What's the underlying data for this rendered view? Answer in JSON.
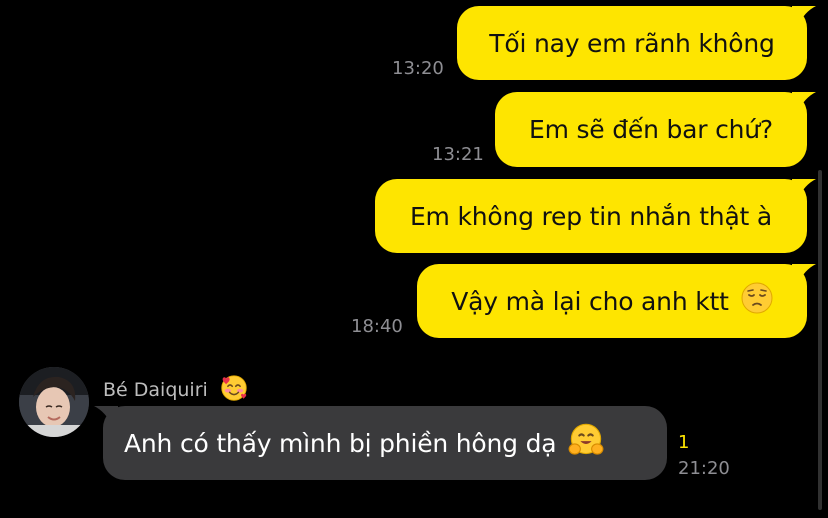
{
  "chat": {
    "messages_out": [
      {
        "text": "Tối nay em rãnh không"
      },
      {
        "text": "Em sẽ đến bar chứ?"
      },
      {
        "text": "Em không rep tin nhắn thật à"
      },
      {
        "text": "Vậy mà lại cho anh ktt"
      }
    ],
    "timestamps": {
      "t1": "13:20",
      "t2": "13:21",
      "t3": "18:40",
      "t4": "21:20"
    },
    "incoming": {
      "sender_name": "Bé Daiquiri",
      "text": "Anh có thấy mình bị phiền hông dạ",
      "unread_count": "1"
    }
  },
  "icons": {
    "pensive": "pensive-face-emoji",
    "smiling_hearts": "smiling-face-with-hearts-emoji",
    "hugging": "hugging-face-emoji"
  },
  "colors": {
    "background": "#000000",
    "outgoing_bubble": "#FEE500",
    "incoming_bubble": "#3A3A3C",
    "timestamp": "#8E8E93",
    "unread": "#FEE500"
  }
}
